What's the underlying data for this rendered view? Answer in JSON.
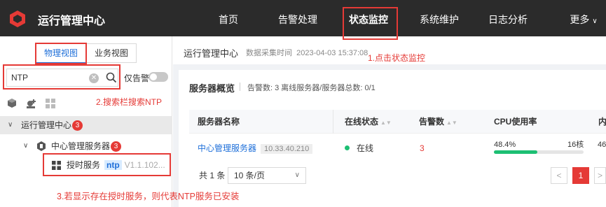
{
  "app": {
    "title": "运行管理中心"
  },
  "nav": {
    "items": [
      "首页",
      "告警处理",
      "状态监控",
      "系统维护",
      "日志分析"
    ],
    "more": "更多"
  },
  "sidebar": {
    "tabs": [
      "物理视图",
      "业务视图"
    ],
    "search": {
      "value": "NTP"
    },
    "toggle_label": "仅告警",
    "tree": {
      "root": {
        "label": "运行管理中心",
        "badge": "3"
      },
      "server": {
        "label": "中心管理服务器",
        "badge": "3"
      },
      "service": {
        "label": "授时服务",
        "tag": "ntp",
        "version": "V1.1.102..."
      }
    }
  },
  "main": {
    "title": "运行管理中心",
    "collect_label": "数据采集时间",
    "collect_time": "2023-04-03 15:37:08",
    "card": {
      "title": "服务器概览",
      "stats": "告警数: 3    离线服务器/服务器总数: 0/1"
    },
    "table": {
      "columns": [
        "服务器名称",
        "在线状态",
        "告警数",
        "CPU使用率",
        "内"
      ],
      "row": {
        "name": "中心管理服务器",
        "ip": "10.33.40.210",
        "status": "在线",
        "alarms": "3",
        "cpu": "48.4%",
        "cores": "16核",
        "mem": "46"
      }
    },
    "pager": {
      "total": "共 1 条",
      "page_size": "10 条/页",
      "current": "1",
      "prev": "<",
      "next": ">"
    }
  },
  "annotations": {
    "step1": "1.点击状态监控",
    "step2": "2.搜索栏搜索NTP",
    "step3": "3.若显示存在授时服务，则代表NTP服务已安装"
  },
  "colors": {
    "accent": "#1e6fd9",
    "alert": "#e53a36",
    "online": "#1dbf73",
    "topbar": "#2b2b2b"
  },
  "cpu_fraction": 0.484
}
